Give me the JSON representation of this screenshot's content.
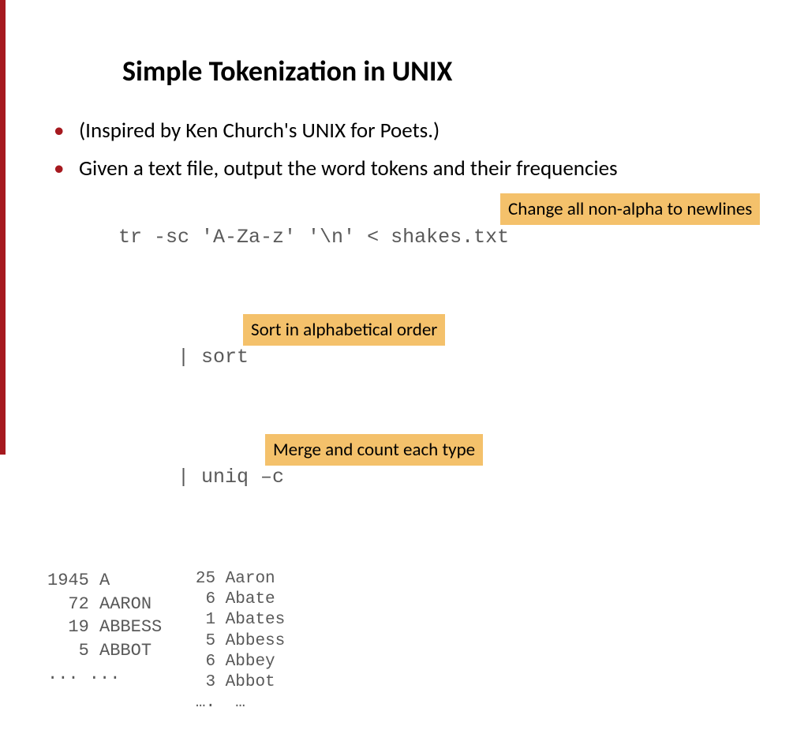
{
  "title": "Simple Tokenization in UNIX",
  "bullets": [
    "(Inspired by Ken Church's UNIX for Poets.)",
    "Given a text file, output the word tokens and their frequencies"
  ],
  "code": {
    "line1": "tr -sc 'A-Za-z' '\\n' < shakes.txt",
    "line2": "     | sort",
    "line3": "     | uniq –c"
  },
  "annotations": {
    "a1": "Change all non-alpha to newlines",
    "a2": "Sort in alphabetical order",
    "a3": "Merge and count each type"
  },
  "output_left": "1945 A\n  72 AARON\n  19 ABBESS\n   5 ABBOT\n... ...",
  "output_right": " 25 Aaron\n  6 Abate\n  1 Abates\n  5 Abbess\n  6 Abbey\n  3 Abbot\n ….  …"
}
